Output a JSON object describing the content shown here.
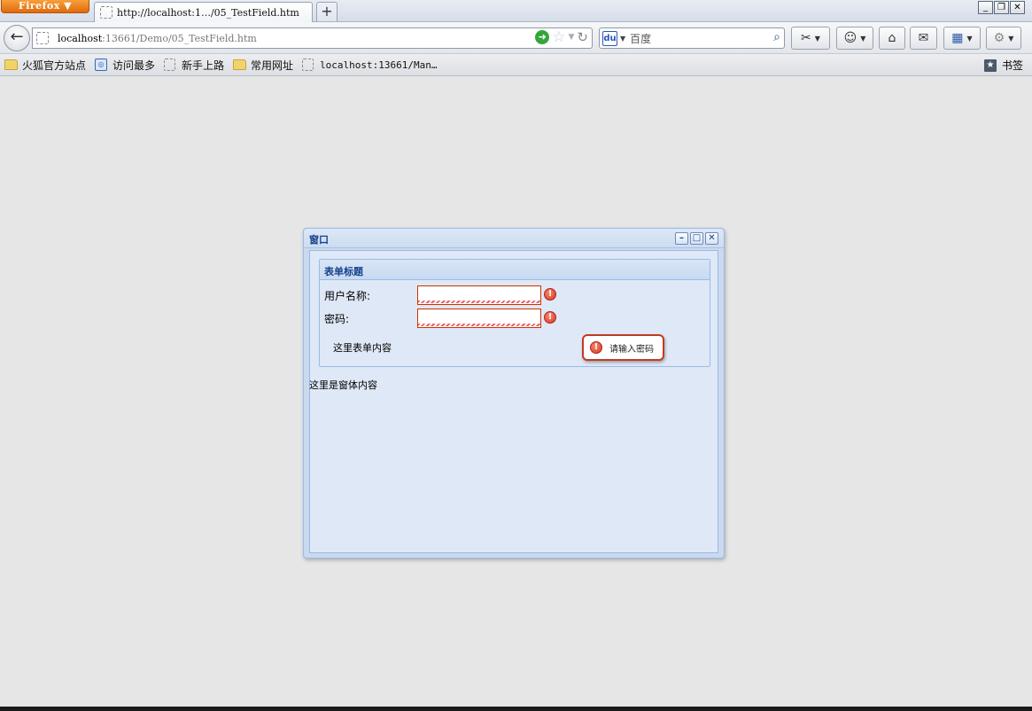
{
  "browser": {
    "menu_button": "Firefox ▼",
    "tab_title": "http://localhost:1…/05_TestField.htm",
    "new_tab": "+",
    "window_controls": [
      "_",
      "❐",
      "✕"
    ]
  },
  "nav": {
    "back_glyph": "←",
    "url_host": "localhost",
    "url_path": ":13661/Demo/05_TestField.htm",
    "search_placeholder": "百度",
    "search_engine_icon": "baidu-paw-icon"
  },
  "bookmarks": {
    "items": [
      {
        "label": "火狐官方站点",
        "icon": "folder-icon"
      },
      {
        "label": "访问最多",
        "icon": "recent-icon"
      },
      {
        "label": "新手上路",
        "icon": "page-icon"
      },
      {
        "label": "常用网址",
        "icon": "folder-icon"
      },
      {
        "label": "localhost:13661/Man…",
        "icon": "page-icon"
      }
    ],
    "right_label": "书签"
  },
  "window": {
    "title": "窗口",
    "tools": [
      "–",
      "□",
      "✕"
    ],
    "content_text": "这里是窗体内容",
    "form": {
      "title": "表单标题",
      "username_label": "用户名称:",
      "username_value": "",
      "password_label": "密码:",
      "password_value": "",
      "content_text": "这里表单内容",
      "error_glyph": "!",
      "tooltip_text": "请输入密码"
    }
  },
  "colors": {
    "window_title": "#15428b",
    "window_border": "#99bbe8",
    "error_border": "#c33a1f"
  }
}
